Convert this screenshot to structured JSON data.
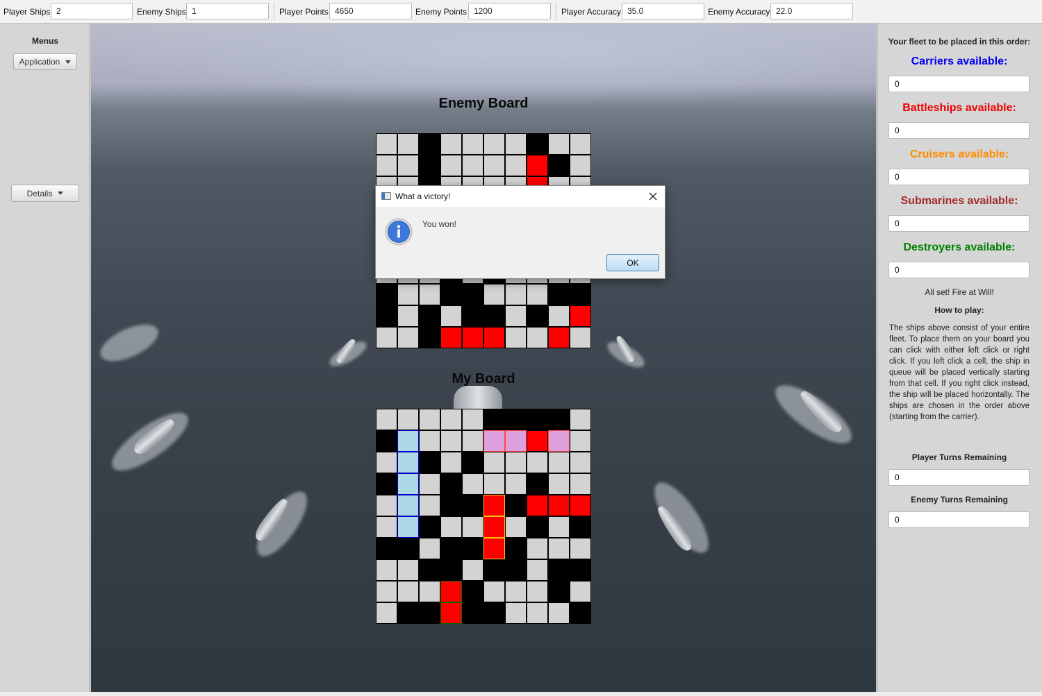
{
  "stats": {
    "player_ships_label": "Player Ships",
    "player_ships_value": "2",
    "enemy_ships_label": "Enemy Ships",
    "enemy_ships_value": "1",
    "player_points_label": "Player Points",
    "player_points_value": "4650",
    "enemy_points_label": "Enemy Points",
    "enemy_points_value": "1200",
    "player_accuracy_label": "Player Accuracy",
    "player_accuracy_value": "35.0",
    "enemy_accuracy_label": "Enemy Accuracy",
    "enemy_accuracy_value": "22.0"
  },
  "left": {
    "menus_title": "Menus",
    "application_button": "Application",
    "details_button": "Details"
  },
  "boards": {
    "enemy_title": "Enemy Board",
    "my_title": "My Board",
    "cell_colors": {
      "g": "#d3d3d3",
      "b": "#000000",
      "r": "#ff0000",
      "L": "#add8e6",
      "P": "#dda0dd"
    },
    "enemy_rows": [
      "ggbgggg bgg",
      "ggbgggg rbg",
      "ggbgggg rgg",
      "gggggggggg",
      "gggggggggg",
      "gggggggggg",
      "gggbgbgggg",
      "bggbbgggbb",
      "bgbgbbgbgr",
      "ggbrrrggr"
    ],
    "my_rows": [
      "gggggbbbbg",
      "bLgggPPrPg",
      "gLbgbggggg",
      "bLgbgggbgg",
      "gLgbbYbrrr",
      "gLbggYgbgb",
      "bbgbbYbggg",
      "ggbbgbbgbb",
      "gggGbgggbg",
      "gbbGbbgggb"
    ]
  },
  "right": {
    "fleet_header": "Your fleet to be placed in this order:",
    "carriers_label": "Carriers available:",
    "carriers_value": "0",
    "carriers_color": "#0000ee",
    "battleships_label": "Battleships available:",
    "battleships_value": "0",
    "battleships_color": "#ee0000",
    "cruisers_label": "Cruisers available:",
    "cruisers_value": "0",
    "cruisers_color": "#ff8c00",
    "submarines_label": "Submarines available:",
    "submarines_value": "0",
    "submarines_color": "#a52a2a",
    "destroyers_label": "Destroyers available:",
    "destroyers_value": "0",
    "destroyers_color": "#008000",
    "status_text": "All set! Fire at Will!",
    "howto_title": "How to play:",
    "howto_text": "The ships above consist of your entire fleet. To place them on your board you can click with either left click or right click. If you left click a cell, the ship in queue will be placed vertically starting from that cell. If you right click instead, the ship will be placed horizontally.  The ships are chosen in the order above (starting from the carrier).",
    "player_turns_label": "Player Turns Remaining",
    "player_turns_value": "0",
    "enemy_turns_label": "Enemy Turns Remaining",
    "enemy_turns_value": "0"
  },
  "dialog": {
    "title": "What a victory!",
    "message": "You won!",
    "ok_button": "OK",
    "accent": "#3c7fb1"
  }
}
